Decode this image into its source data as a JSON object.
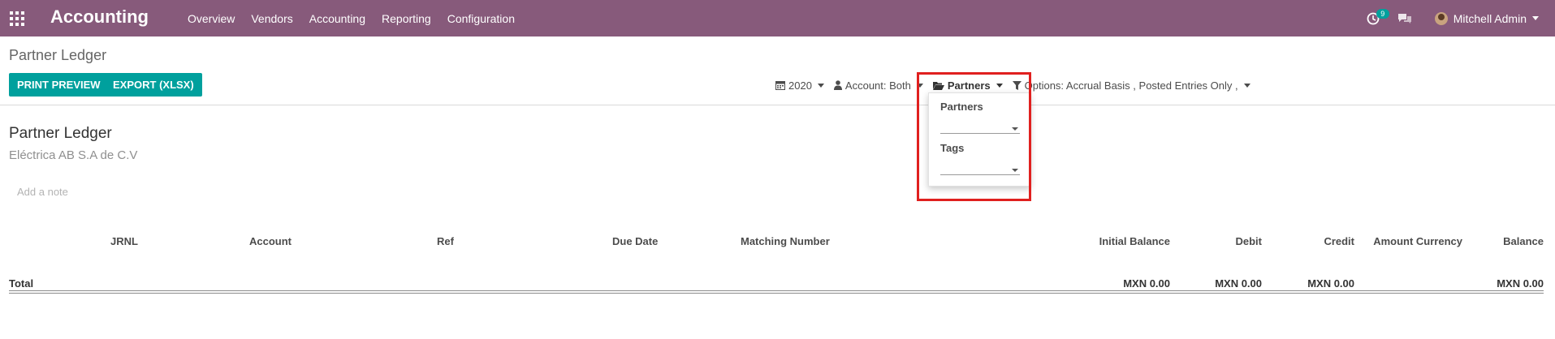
{
  "navbar": {
    "brand": "Accounting",
    "menu": [
      "Overview",
      "Vendors",
      "Accounting",
      "Reporting",
      "Configuration"
    ],
    "activity_count": "9",
    "user_name": "Mitchell Admin"
  },
  "control_panel": {
    "breadcrumb": "Partner Ledger",
    "buttons": {
      "print_preview": "PRINT PREVIEW",
      "export": "EXPORT (XLSX)"
    },
    "filters": {
      "date": "2020",
      "account": "Account: Both",
      "partners": "Partners",
      "options": "Options: Accrual Basis , Posted Entries Only ,"
    }
  },
  "partners_dropdown": {
    "partners_label": "Partners",
    "tags_label": "Tags"
  },
  "report": {
    "title": "Partner Ledger",
    "company": "Eléctrica AB S.A de C.V",
    "add_note": "Add a note",
    "columns": [
      "JRNL",
      "Account",
      "Ref",
      "Due Date",
      "Matching Number",
      "Initial Balance",
      "Debit",
      "Credit",
      "Amount Currency",
      "Balance"
    ],
    "total": {
      "label": "Total",
      "initial_balance": "MXN 0.00",
      "debit": "MXN 0.00",
      "credit": "MXN 0.00",
      "balance": "MXN 0.00"
    }
  },
  "colors": {
    "brand": "#875a7b",
    "primary": "#00a09d",
    "highlight": "#e0201f"
  }
}
